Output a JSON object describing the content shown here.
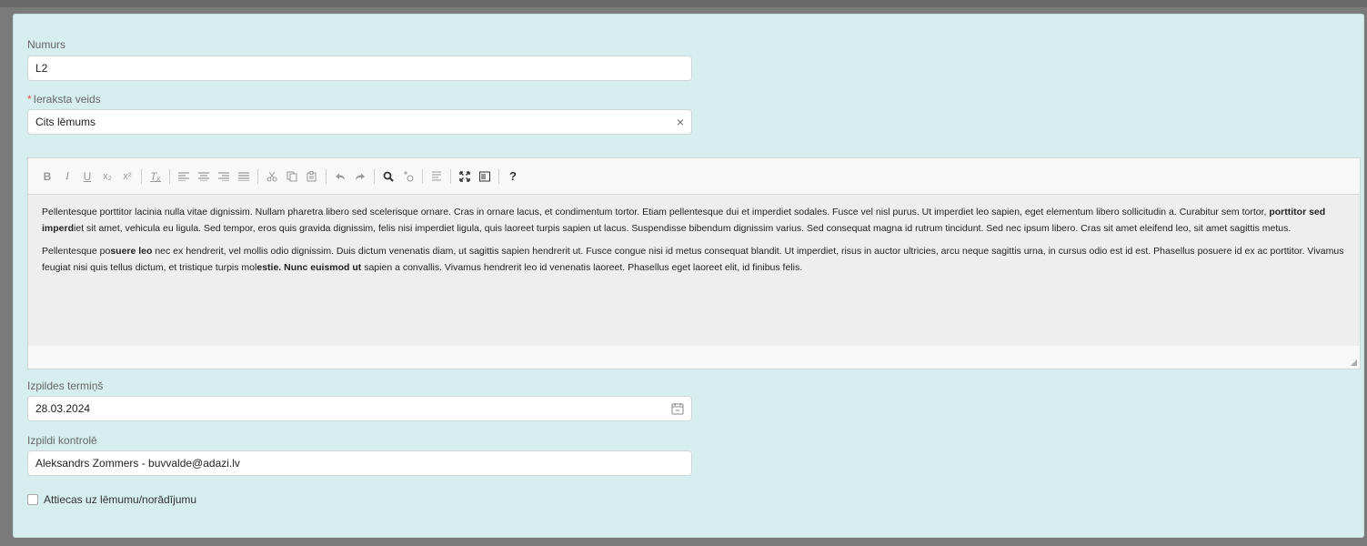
{
  "form": {
    "number": {
      "label": "Numurs",
      "value": "L2"
    },
    "record_type": {
      "required_mark": "*",
      "label": "Ieraksta veids",
      "value": "Cits lēmums",
      "clear_glyph": "×"
    },
    "due_date": {
      "label": "Izpildes termiņš",
      "value": "28.03.2024"
    },
    "controller": {
      "label": "Izpildi kontrolē",
      "value": "Aleksandrs Zommers - buvvalde@adazi.lv"
    },
    "checkbox": {
      "label": "Attiecas uz lēmumu/norādījumu",
      "checked": false
    }
  },
  "editor": {
    "toolbar": {
      "bold": "B",
      "italic": "I",
      "underline": "U",
      "subscript": "x₂",
      "superscript": "x²",
      "remove_format": "Tₓ",
      "help": "?"
    },
    "paragraphs": [
      {
        "parts": [
          {
            "text": "Pellentesque porttitor lacinia nulla vitae dignissim. Nullam pharetra libero sed scelerisque ornare. Cras in ornare lacus, et condimentum tortor. Etiam pellentesque dui et imperdiet sodales. Fusce vel nisl purus. Ut imperdiet leo sapien, eget elementum libero sollicitudin a. Curabitur sem tortor, "
          },
          {
            "text": "porttitor sed imperd",
            "bold": true
          },
          {
            "text": "iet sit amet, vehicula eu ligula. Sed tempor, eros quis gravida dignissim, felis nisi imperdiet ligula, quis laoreet turpis sapien ut lacus. Suspendisse bibendum dignissim varius. Sed consequat magna id rutrum tincidunt. Sed nec ipsum libero. Cras sit amet eleifend leo, sit amet sagittis metus."
          }
        ]
      },
      {
        "parts": [
          {
            "text": "Pellentesque po"
          },
          {
            "text": "suere leo",
            "bold": true
          },
          {
            "text": " nec ex hendrerit, vel mollis odio dignissim. Duis dictum venenatis diam, ut sagittis sapien hendrerit ut. Fusce congue nisi id metus consequat blandit. Ut imperdiet, risus in auctor ultricies, arcu neque sagittis urna, in cursus odio est id est. Phasellus posuere id ex ac porttitor. Vivamus feugiat nisi quis tellus dictum, et tristique turpis mol"
          },
          {
            "text": "estie. Nunc euismod ut",
            "bold": true
          },
          {
            "text": " sapien a convallis. Vivamus hendrerit leo id venenatis laoreet. Phasellus eget laoreet elit, id finibus felis."
          }
        ]
      }
    ]
  }
}
